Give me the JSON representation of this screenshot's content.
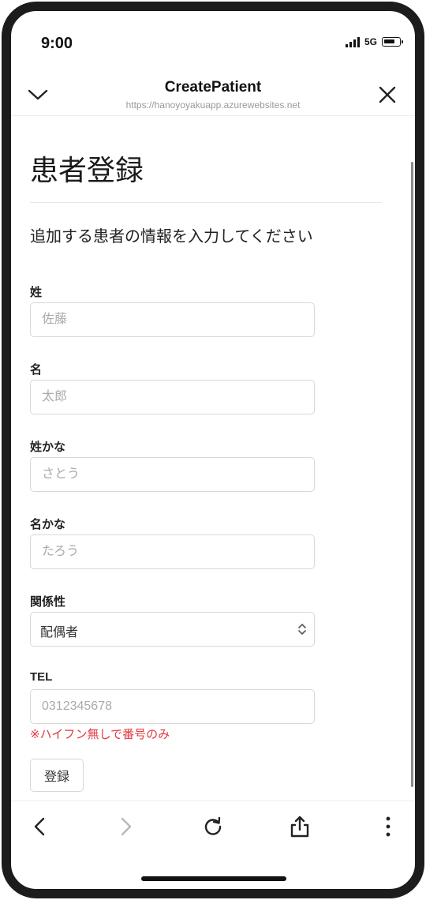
{
  "status_bar": {
    "time": "9:00",
    "network": "5G",
    "icons": [
      "signal-icon",
      "battery-icon"
    ]
  },
  "nav": {
    "title": "CreatePatient",
    "url": "https://hanoyoyakuapp.azurewebsites.net",
    "icons": [
      "chevron-down-icon",
      "close-icon"
    ]
  },
  "page": {
    "title": "患者登録",
    "subtitle": "追加する患者の情報を入力してください"
  },
  "form": {
    "last_name": {
      "label": "姓",
      "placeholder": "佐藤"
    },
    "first_name": {
      "label": "名",
      "placeholder": "太郎"
    },
    "last_name_kana": {
      "label": "姓かな",
      "placeholder": "さとう"
    },
    "first_name_kana": {
      "label": "名かな",
      "placeholder": "たろう"
    },
    "relationship": {
      "label": "関係性",
      "selected": "配偶者"
    },
    "tel": {
      "label": "TEL",
      "placeholder": "0312345678",
      "hint": "※ハイフン無しで番号のみ"
    },
    "submit_label": "登録"
  },
  "toolbar": {
    "icons": [
      "back-icon",
      "forward-icon",
      "reload-icon",
      "share-icon",
      "more-icon"
    ]
  },
  "colors": {
    "hint_text": "#e0383e",
    "border": "#d8d8d8",
    "placeholder": "#aaaaaa",
    "frame": "#1c1c1c"
  }
}
